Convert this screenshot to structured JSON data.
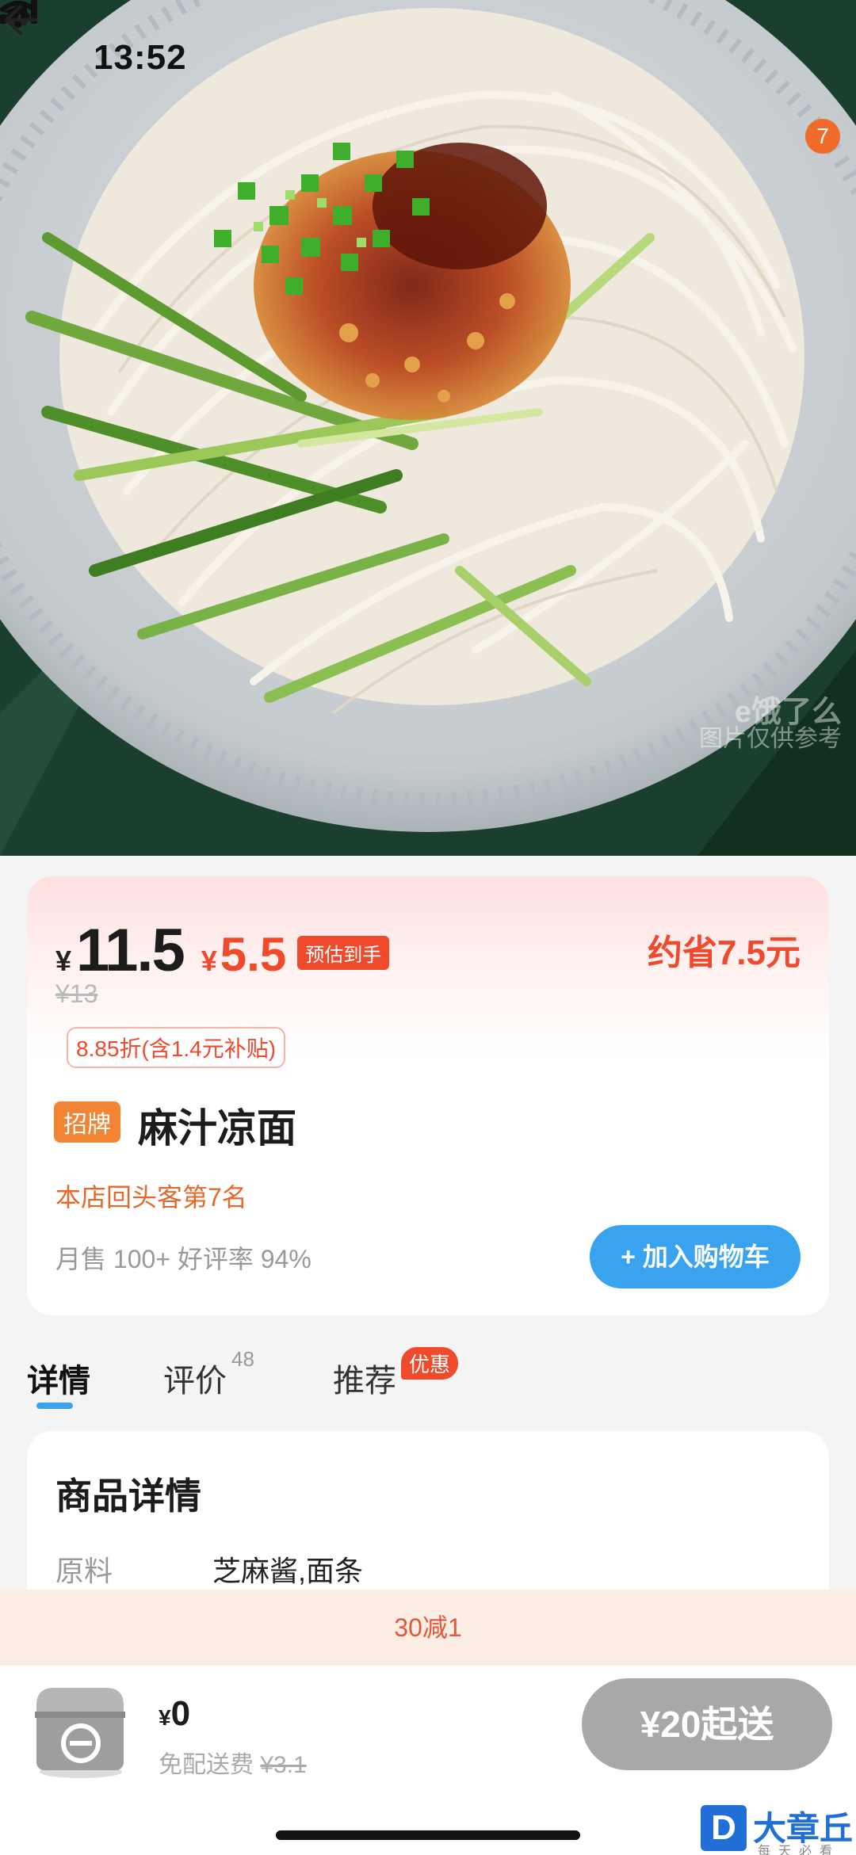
{
  "status_bar": {
    "time": "13:52"
  },
  "header": {
    "notification_count": "7"
  },
  "hero": {
    "watermark_logo": "e饿了么",
    "watermark_text": "图片仅供参考"
  },
  "product": {
    "currency": "¥",
    "price": "11.5",
    "final_price": "5.5",
    "est_label": "预估到手",
    "save_text": "约省7.5元",
    "original_price": "¥13",
    "discount_text": "8.85折(含1.4元补贴)",
    "signature_tag": "招牌",
    "name": "麻汁凉面",
    "repeat_rank": "本店回头客第7名",
    "sales_text": "月售 100+ 好评率 94%",
    "add_to_cart": "+ 加入购物车"
  },
  "tabs": {
    "details": "详情",
    "reviews": "评价",
    "reviews_count": "48",
    "recommend": "推荐",
    "recommend_badge": "优惠"
  },
  "details": {
    "title": "商品详情",
    "ingredient_label": "原料",
    "ingredient_value": "芝麻酱,面条"
  },
  "promo_bar": {
    "text": "30减1"
  },
  "bottom_bar": {
    "currency": "¥",
    "cart_total": "0",
    "delivery_label": "免配送费",
    "delivery_original": "¥3.1",
    "min_order_button": "¥20起送"
  },
  "corner_brand": {
    "letter": "D",
    "name": "大章丘",
    "tagline": "每天必看"
  }
}
